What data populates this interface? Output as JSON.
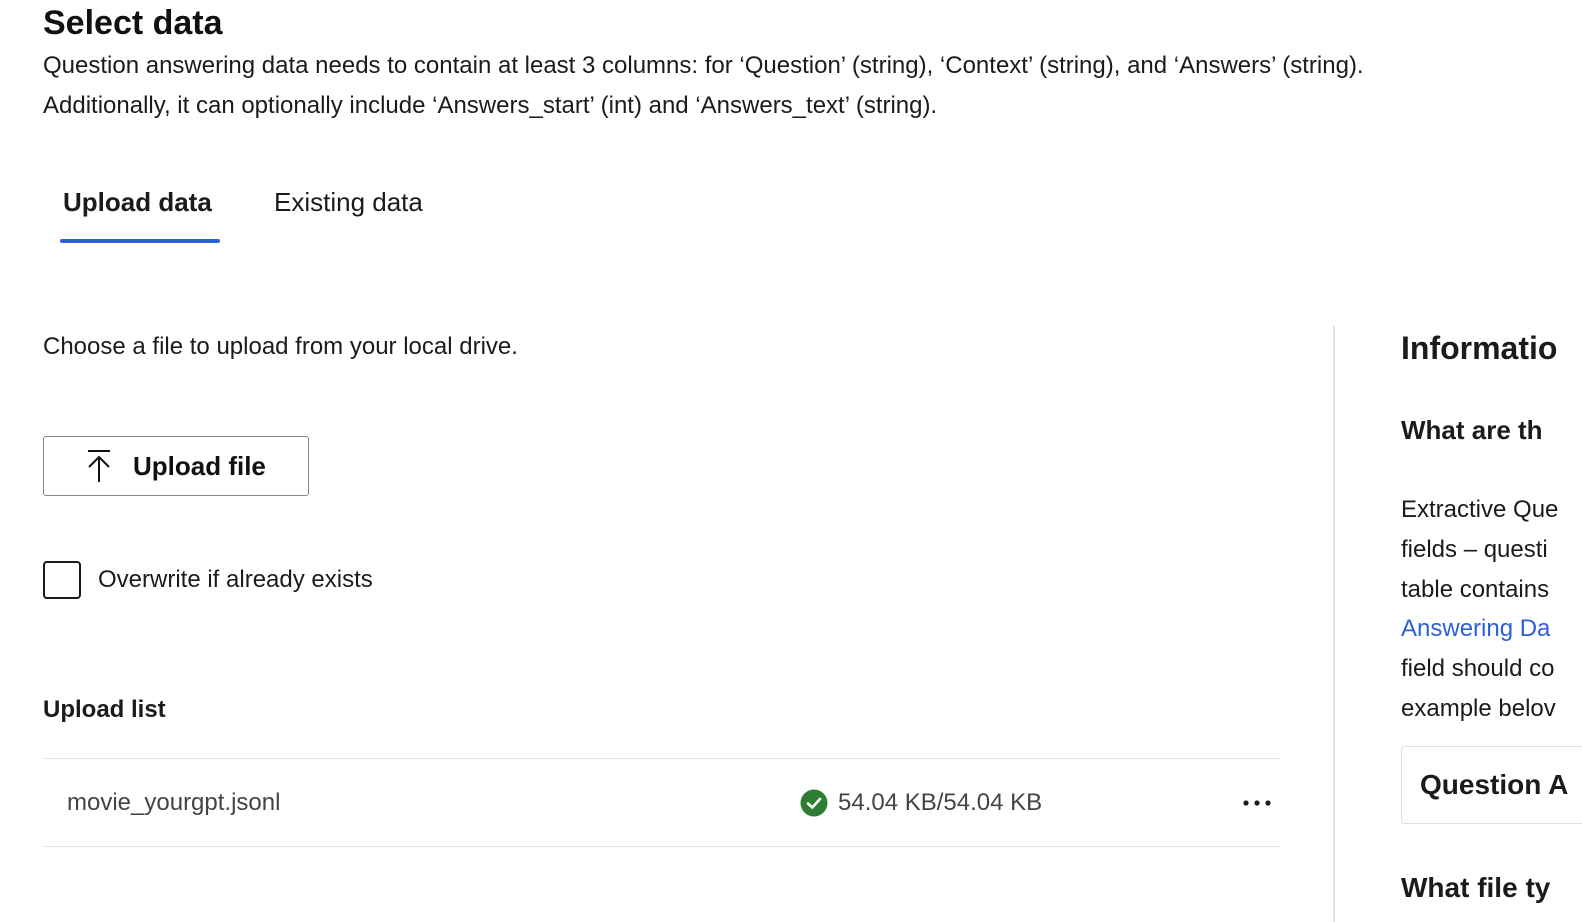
{
  "page": {
    "title": "Select data",
    "description_lines": [
      "Question answering data needs to contain at least 3 columns: for ‘Question’ (string), ‘Context’ (string), and ‘Answers’ (string).",
      "Additionally, it can optionally include ‘Answers_start’ (int) and ‘Answers_text’ (string)."
    ]
  },
  "tabs": [
    {
      "label": "Upload data",
      "active": true
    },
    {
      "label": "Existing data",
      "active": false
    }
  ],
  "upload": {
    "instruction": "Choose a file to upload from your local drive.",
    "upload_button_label": "Upload file",
    "upload_icon": "upload-arrow-icon",
    "overwrite_label": "Overwrite if already exists",
    "overwrite_checked": false
  },
  "upload_list": {
    "title": "Upload list",
    "items": [
      {
        "file_name": "movie_yourgpt.jsonl",
        "progress": "54.04 KB/54.04 KB",
        "status_icon": "success-check-icon",
        "more_icon": "more-options-icon"
      }
    ]
  },
  "info_panel": {
    "title": "Informatio",
    "question_1": "What are th",
    "paragraph_lines": [
      {
        "text": "Extractive Que",
        "link": false
      },
      {
        "text": "fields – questi",
        "link": false
      },
      {
        "text": "table contains",
        "link": false
      },
      {
        "text": "Answering Da",
        "link": true
      },
      {
        "text": "field should co",
        "link": false
      },
      {
        "text": "example belov",
        "link": false
      }
    ],
    "table_column": "Question A",
    "question_2": "What file ty"
  },
  "colors": {
    "accent": "#2d5fd8",
    "success": "#2e7d32",
    "divider": "#e2e2e2"
  }
}
